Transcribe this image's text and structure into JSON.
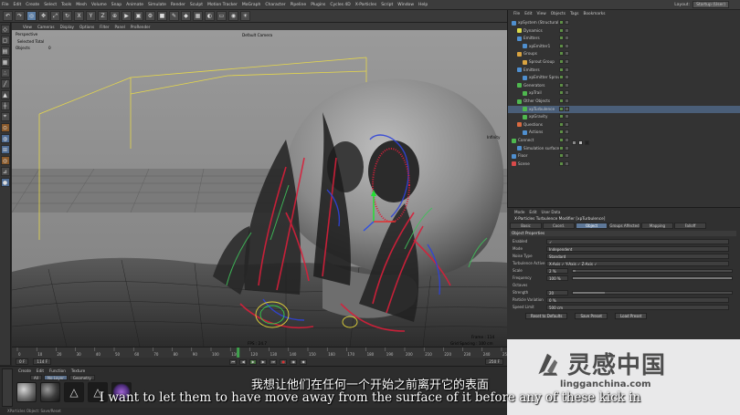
{
  "menubar": {
    "items": [
      "File",
      "Edit",
      "Create",
      "Select",
      "Tools",
      "Mesh",
      "Volume",
      "Snap",
      "Animate",
      "Simulate",
      "Render",
      "Sculpt",
      "Motion Tracker",
      "MoGraph",
      "Character",
      "Pipeline",
      "Plugins",
      "Cycles 4D",
      "X-Particles",
      "Script",
      "Window",
      "Help"
    ],
    "layout_label": "Layout:",
    "layout_value": "Startup (User)"
  },
  "viewport": {
    "menu": [
      "View",
      "Cameras",
      "Display",
      "Options",
      "Filter",
      "Panel",
      "ProRender"
    ],
    "camera_label": "Default Camera",
    "selection_title": "Selected Total",
    "objects_label": "Objects",
    "objects_value": "0",
    "perspective_label": "Perspective",
    "fps_label": "FPS : 24.7",
    "frame_label": "Frame : 114",
    "grid_label": "Grid Spacing : 100 cm",
    "infinity_label": "Infinity"
  },
  "timeline": {
    "ticks": [
      "0",
      "10",
      "20",
      "30",
      "40",
      "50",
      "60",
      "70",
      "80",
      "90",
      "100",
      "110",
      "120",
      "130",
      "140",
      "150",
      "160",
      "170",
      "180",
      "190",
      "200",
      "210",
      "220",
      "230",
      "240",
      "250"
    ],
    "frame_start": "0 F",
    "frame_end": "250 F",
    "current_frame": "114 F"
  },
  "materials": {
    "menu": [
      "Create",
      "Edit",
      "Function",
      "Texture"
    ],
    "tabs": [
      "All",
      "No Layer",
      "Geometry"
    ],
    "active_tab": "No Layer"
  },
  "status_text": "XParticles Object: Save/Reset",
  "object_manager": {
    "menu": [
      "File",
      "Edit",
      "View",
      "Objects",
      "Tags",
      "Bookmarks"
    ],
    "rows": [
      {
        "label": "xpSystem (Structural)",
        "indent": 0,
        "color": "#4f8fcf"
      },
      {
        "label": "Dynamics",
        "indent": 1,
        "color": "#d9d94a"
      },
      {
        "label": "Emitters",
        "indent": 1,
        "color": "#4f8fcf"
      },
      {
        "label": "xpEmitter1",
        "indent": 2,
        "color": "#4f8fcf"
      },
      {
        "label": "Groups",
        "indent": 1,
        "color": "#d9a340"
      },
      {
        "label": "Sprout Group",
        "indent": 2,
        "color": "#d9a340"
      },
      {
        "label": "Emitters",
        "indent": 1,
        "color": "#4f8fcf"
      },
      {
        "label": "xpEmitter Sprouts",
        "indent": 2,
        "color": "#4f8fcf"
      },
      {
        "label": "Generators",
        "indent": 1,
        "color": "#4fb84f"
      },
      {
        "label": "xpTrail",
        "indent": 2,
        "color": "#4fb84f"
      },
      {
        "label": "Other Objects",
        "indent": 1,
        "color": "#4fb84f"
      },
      {
        "label": "xpTurbulence",
        "indent": 2,
        "color": "#4fb84f"
      },
      {
        "label": "xpGravity",
        "indent": 2,
        "color": "#4fb84f"
      },
      {
        "label": "Questions",
        "indent": 1,
        "color": "#d96a40"
      },
      {
        "label": "Actions",
        "indent": 2,
        "color": "#4f8fcf"
      },
      {
        "label": "Connect",
        "indent": 0,
        "color": "#4fb84f"
      },
      {
        "label": "Simulation surface",
        "indent": 1,
        "color": "#4f8fcf"
      },
      {
        "label": "Floor",
        "indent": 0,
        "color": "#4f8fcf"
      },
      {
        "label": "Scene",
        "indent": 0,
        "color": "#d94a4a"
      }
    ]
  },
  "attributes": {
    "menu": [
      "Mode",
      "Edit",
      "User Data"
    ],
    "title": "X-Particles Turbulence Modifier [xpTurbulence]",
    "tabs": [
      "Basic",
      "Coord.",
      "Object",
      "Groups Affected",
      "Mapping",
      "Falloff"
    ],
    "active_tab": "Object",
    "section": "Object Properties",
    "props": [
      {
        "label": "Enabled",
        "value": "✓",
        "slider": null
      },
      {
        "label": "Mode",
        "value": "Independent",
        "slider": null
      },
      {
        "label": "Noise Type",
        "value": "Standard",
        "slider": null
      },
      {
        "label": "Turbulence Active on Axis",
        "value": "X-Axis ✓  Y-Axis ✓  Z-Axis ✓",
        "slider": null
      },
      {
        "label": "Scale",
        "value": "2 %",
        "slider": 0.02
      },
      {
        "label": "Frequency",
        "value": "100 %",
        "slider": 1.0
      },
      {
        "label": "Octaves",
        "value": "",
        "slider": null
      },
      {
        "label": "Strength",
        "value": "20",
        "slider": 0.2
      },
      {
        "label": "Particle Variation",
        "value": "0 %",
        "slider": null
      },
      {
        "label": "Speed Limit",
        "value": "500 cm",
        "slider": null
      }
    ],
    "buttons": [
      "Reset to Defaults",
      "Save Preset",
      "Load Preset"
    ]
  },
  "watermark": {
    "text": "灵感中国",
    "url": "lingganchina.com"
  },
  "subtitles": {
    "chinese": "我想让他们在任何一个开始之前离开它的表面",
    "english": "I want to let them to have move away from the surface of it before any of these kick in"
  }
}
